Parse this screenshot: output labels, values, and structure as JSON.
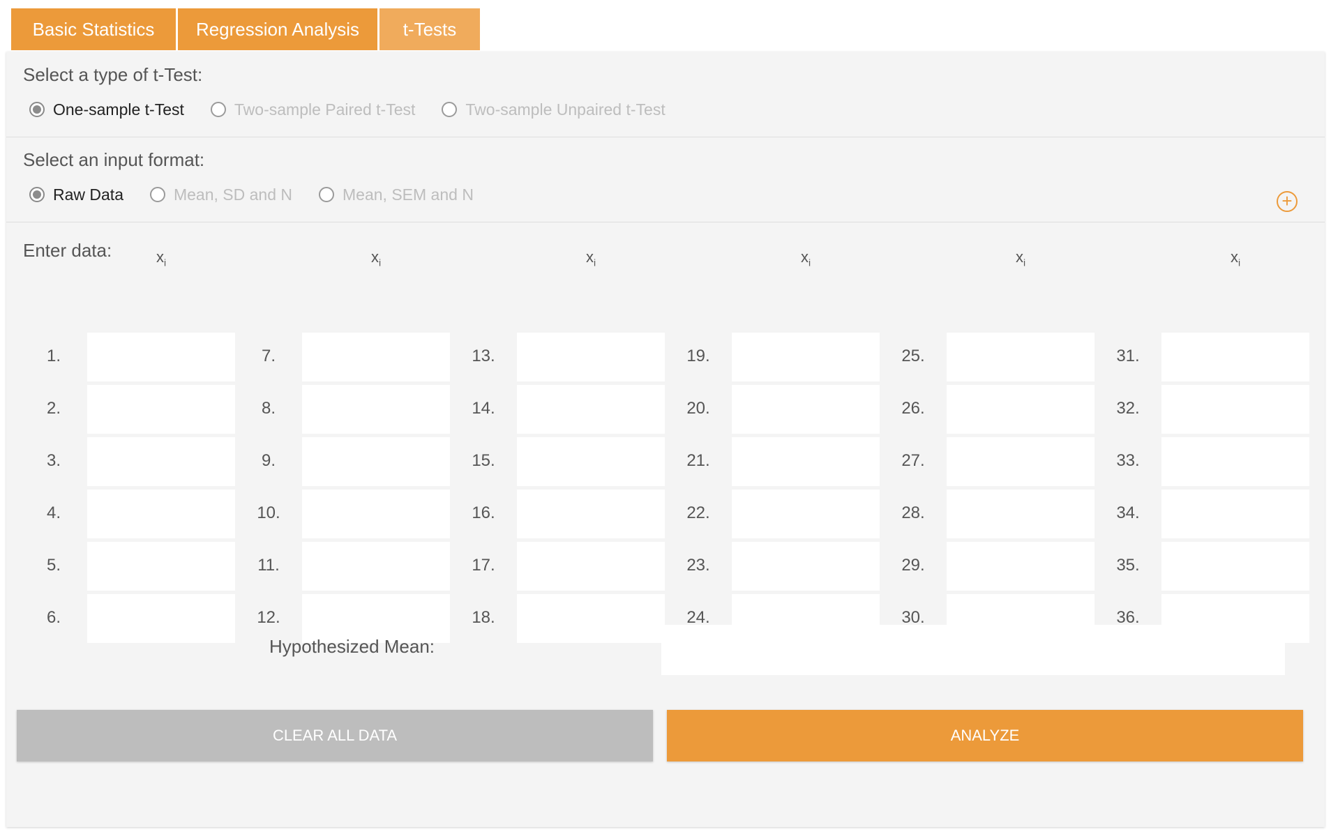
{
  "tabs": [
    {
      "label": "Basic Statistics",
      "active": false
    },
    {
      "label": "Regression Analysis",
      "active": false
    },
    {
      "label": "t-Tests",
      "active": true
    }
  ],
  "test_type": {
    "label": "Select a type of t-Test:",
    "options": [
      {
        "label": "One-sample t-Test",
        "checked": true
      },
      {
        "label": "Two-sample Paired t-Test",
        "checked": false
      },
      {
        "label": "Two-sample Unpaired t-Test",
        "checked": false
      }
    ]
  },
  "input_format": {
    "label": "Select an input format:",
    "options": [
      {
        "label": "Raw Data",
        "checked": true
      },
      {
        "label": "Mean, SD and N",
        "checked": false
      },
      {
        "label": "Mean, SEM and N",
        "checked": false
      }
    ]
  },
  "data_entry": {
    "label": "Enter data:",
    "add_icon": "plus-circle-icon",
    "column_header": "x",
    "column_header_sub": "i",
    "rows": [
      "1.",
      "2.",
      "3.",
      "4.",
      "5.",
      "6.",
      "7.",
      "8.",
      "9.",
      "10.",
      "11.",
      "12.",
      "13.",
      "14.",
      "15.",
      "16.",
      "17.",
      "18.",
      "19.",
      "20.",
      "21.",
      "22.",
      "23.",
      "24.",
      "25.",
      "26.",
      "27.",
      "28.",
      "29.",
      "30.",
      "31.",
      "32.",
      "33.",
      "34.",
      "35.",
      "36."
    ]
  },
  "hypothesized_mean": {
    "label": "Hypothesized Mean:",
    "value": ""
  },
  "buttons": {
    "clear": "CLEAR ALL DATA",
    "analyze": "ANALYZE"
  },
  "colors": {
    "accent": "#ec9a3a",
    "active_tab": "#f0ab5c",
    "clear_button": "#bdbdbd",
    "panel": "#f4f4f4"
  }
}
